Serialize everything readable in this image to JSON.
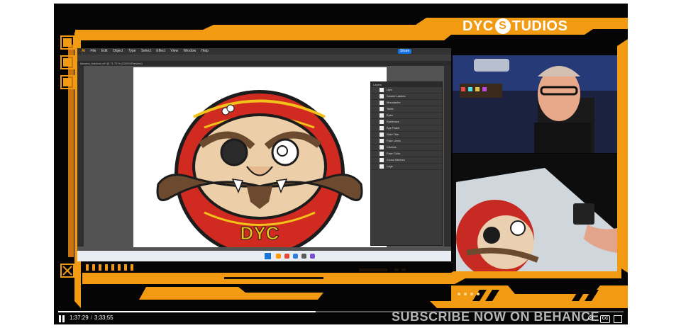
{
  "overlay": {
    "brand": {
      "prefix": "DYC",
      "mark": "S",
      "suffix": "TUDIOS"
    },
    "subscribe_text": "SUBSCRIBE NOW ON BEHANCE"
  },
  "player": {
    "current_time": "1:37:29",
    "separator": "/",
    "duration": "3:33:55",
    "progress": 0.455,
    "captions_label": "CC",
    "icons": [
      "pause-icon",
      "settings-icon",
      "captions-icon",
      "fullscreen-icon"
    ]
  },
  "illustrator": {
    "menu": [
      "File",
      "Edit",
      "Object",
      "Type",
      "Select",
      "Effect",
      "View",
      "Window",
      "Help"
    ],
    "share_label": "Share",
    "tabs_text": "daruma_fraidoon.ai* @ 71.75 % (CMYK/Preview)",
    "layers_header": "Layers",
    "layer_names": [
      "Lips",
      "Smoke Lashes",
      "Moustache",
      "Teeth",
      "Eyes",
      "Eyebrows",
      "Eye Patch",
      "Gold Trim",
      "Face Lines",
      "Cheeks",
      "Face Color",
      "Cross Stitches",
      "Logo"
    ],
    "artwork_text": "DYC",
    "colors": {
      "red": "#d12a20",
      "gold": "#f2c21a",
      "skin": "#eccfa8",
      "brown": "#6b4a2f",
      "outline": "#1c1c1c"
    }
  },
  "colors": {
    "accent": "#f29a12",
    "frame_dark": "#1a1208",
    "background": "#050505"
  }
}
